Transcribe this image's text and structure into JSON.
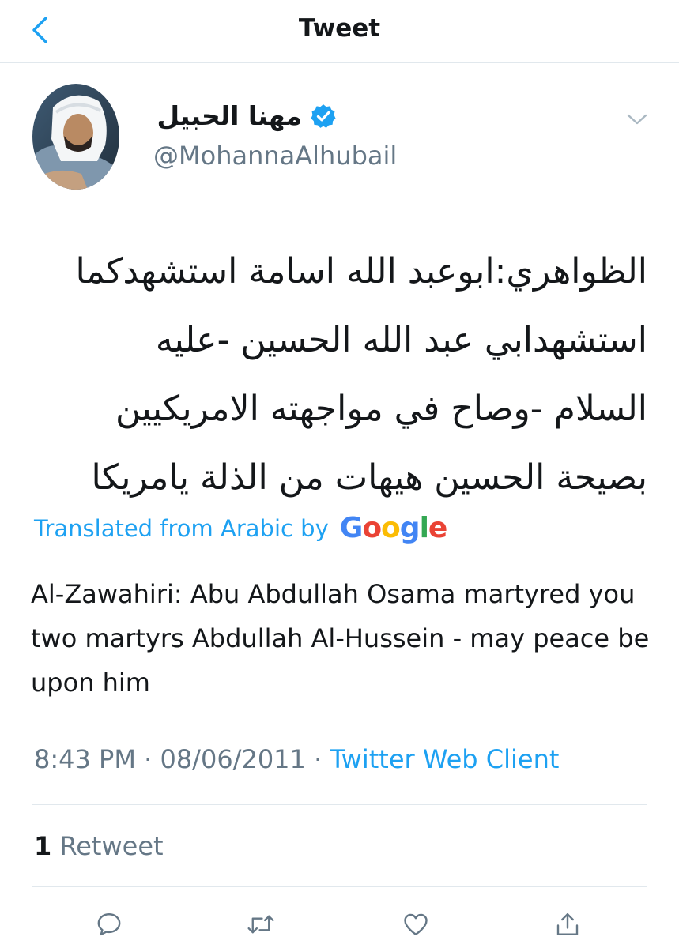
{
  "header": {
    "title": "Tweet",
    "back_icon": "chevron-left-icon"
  },
  "tweet": {
    "author": {
      "display_name": "مهنا الحبيل",
      "handle": "@MohannaAlhubail",
      "verified": true
    },
    "text_lines": [
      "الظواهري:ابوعبد الله اسامة استشهدكما",
      "استشهدابي عبد الله الحسين -عليه",
      "السلام -وصاح في مواجهته الامريكيين",
      "بصيحة الحسين هيهات من الذلة يامريكا"
    ],
    "translated_label": "Translated from Arabic by",
    "translator_logo": [
      "G",
      "o",
      "o",
      "g",
      "l",
      "e"
    ],
    "translation": "Al-Zawahiri: Abu Abdullah Osama martyred you two martyrs Abdullah Al-Hussein - may peace be upon him",
    "time": "8:43 PM",
    "date": "08/06/2011",
    "separator": "·",
    "source": "Twitter Web Client",
    "retweet_count": "1",
    "retweet_label": "Retweet"
  },
  "actions": [
    {
      "name": "reply-button",
      "icon": "speech-bubble-icon"
    },
    {
      "name": "retweet-button",
      "icon": "retweet-icon"
    },
    {
      "name": "like-button",
      "icon": "heart-icon"
    },
    {
      "name": "share-button",
      "icon": "share-icon"
    }
  ],
  "colors": {
    "accent": "#1da1f2",
    "secondary_text": "#657786",
    "primary_text": "#14171a",
    "divider": "#e1e8ed",
    "google_blue": "#4285f4",
    "google_red": "#ea4335",
    "google_yellow": "#fbbc05",
    "google_green": "#34a853"
  }
}
